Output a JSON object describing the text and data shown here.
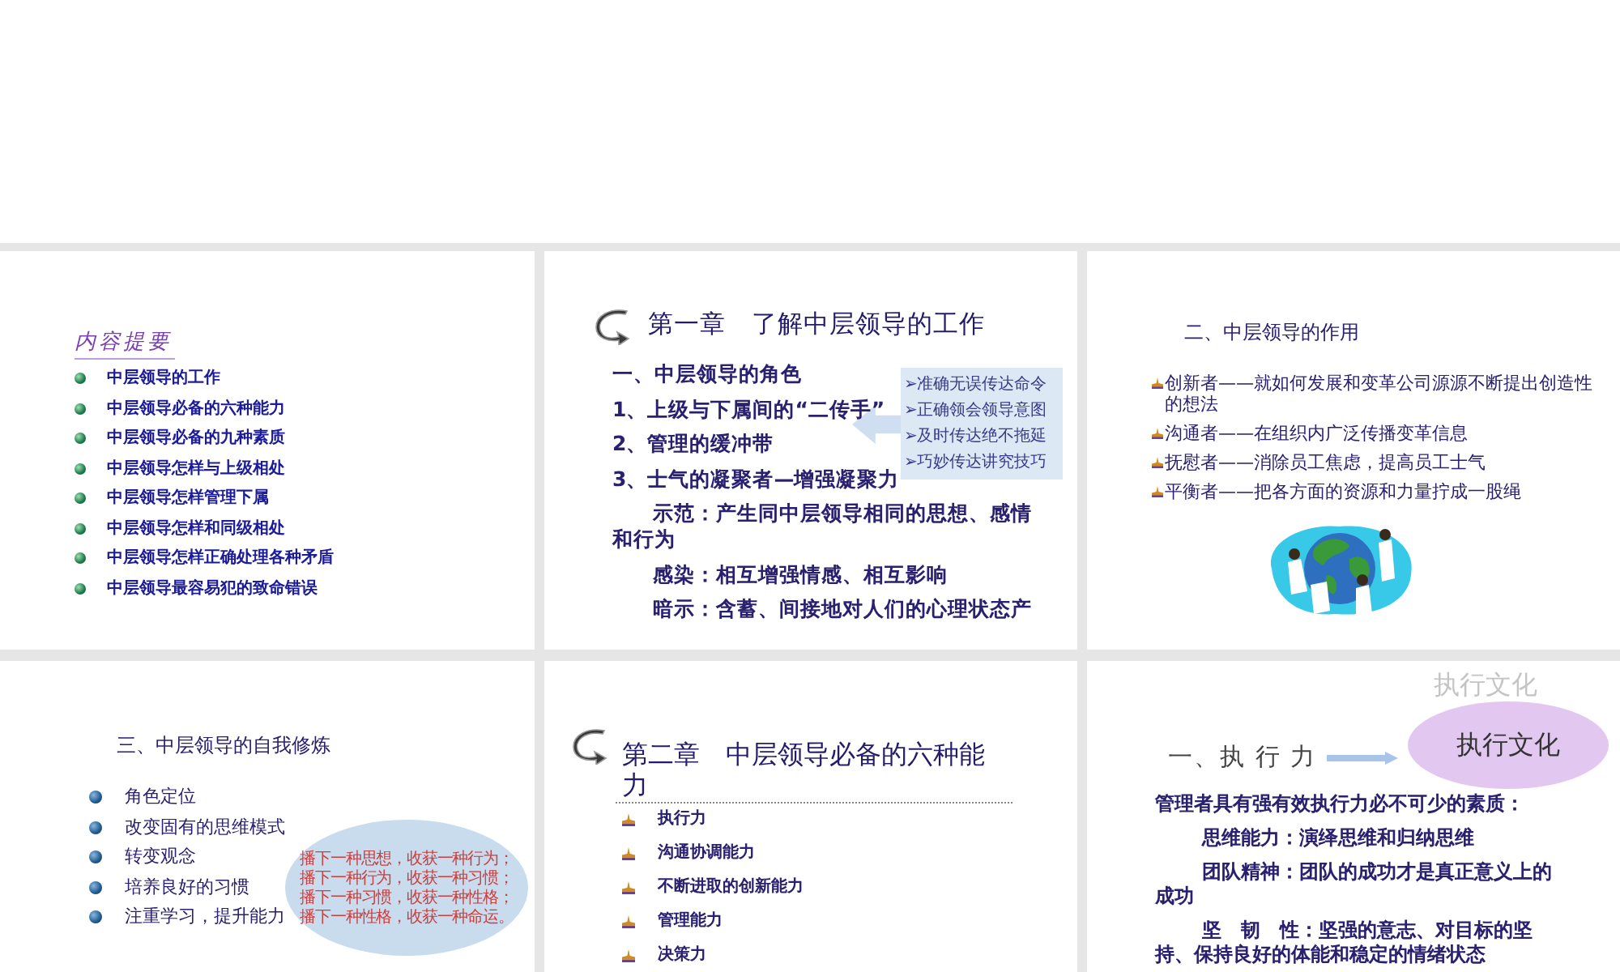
{
  "slides": [
    {
      "kind": "toc",
      "heading": "内容提要",
      "items": [
        "中层领导的工作",
        "中层领导必备的六种能力",
        "中层领导必备的九种素质",
        "中层领导怎样与上级相处",
        "中层领导怎样管理下属",
        "中层领导怎样和同级相处",
        "中层领导怎样正确处理各种矛盾",
        "中层领导最容易犯的致命错误"
      ]
    },
    {
      "kind": "chapter",
      "title": "第一章　了解中层领导的工作",
      "lines": [
        {
          "text": "一、中层领导的角色",
          "indent": false
        },
        {
          "text": "1、上级与下属间的“二传手”",
          "indent": false
        },
        {
          "text": "2、管理的缓冲带",
          "indent": false
        },
        {
          "text": "3、士气的凝聚者—增强凝聚力",
          "indent": false
        },
        {
          "text": "示范：产生同中层领导相同的思想、感情和行为",
          "indent": true
        },
        {
          "text": "感染：相互增强情感、相互影响",
          "indent": true
        },
        {
          "text": "暗示：含蓄、间接地对人们的心理状态产",
          "indent": true
        }
      ],
      "callout": [
        "➢准确无误传达命令",
        "➢正确领会领导意图",
        "➢及时传达绝不拖延",
        "➢巧妙传达讲究技巧"
      ]
    },
    {
      "kind": "roles",
      "heading": "二、中层领导的作用",
      "items": [
        "创新者——就如何发展和变革公司源源不断提出创造性的想法",
        "沟通者——在组织内广泛传播变革信息",
        "抚慰者——消除员工焦虑，提高员工士气",
        "平衡者——把各方面的资源和力量拧成一股绳"
      ],
      "picture": {
        "kind": "picture"
      }
    },
    {
      "kind": "practice",
      "heading": "三、中层领导的自我修炼",
      "items": [
        "角色定位",
        "改变固有的思维模式",
        "转变观念",
        "培养良好的习惯",
        "注重学习，提升能力"
      ],
      "note": [
        "播下一种思想，收获一种行为；",
        "播下一种行为，收获一种习惯；",
        "播下一种习惯，收获一种性格；",
        "播下一种性格，收获一种命运。"
      ]
    },
    {
      "kind": "chapter_list",
      "title": "第二章　中层领导必备的六种能力",
      "items": [
        "执行力",
        "沟通协调能力",
        "不断进取的创新能力",
        "管理能力",
        "决策力"
      ]
    },
    {
      "kind": "execution",
      "heading": "一、执 行 力",
      "badge": "执行文化",
      "badge_ghost": "执行文化",
      "lines": [
        {
          "text": "管理者具有强有效执行力必不可少的素质：",
          "indent": false
        },
        {
          "text": "思维能力：演绎思维和归纳思维",
          "indent": true
        },
        {
          "text": "团队精神：团队的成功才是真正意义上的成功",
          "indent": true
        },
        {
          "text": "坚　韧　性：坚强的意志、对目标的坚持、保持良好的体能和稳定的情绪状态",
          "indent": true
        }
      ]
    }
  ]
}
